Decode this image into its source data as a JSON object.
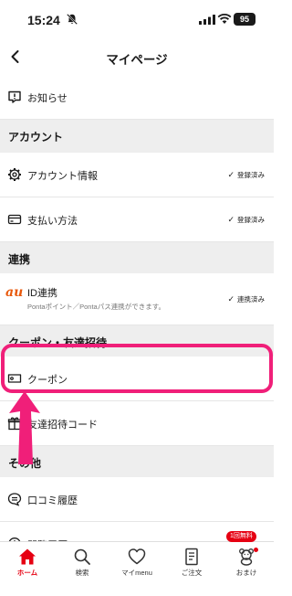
{
  "status_bar": {
    "time": "15:24",
    "battery": "95"
  },
  "header": {
    "title": "マイページ"
  },
  "notice": {
    "label": "お知らせ"
  },
  "sections": {
    "account": "アカウント",
    "link": "連携",
    "coupon": "クーポン・友達招待",
    "other": "その他"
  },
  "account_info": {
    "label": "アカウント情報",
    "status": "登録済み"
  },
  "payment": {
    "label": "支払い方法",
    "status": "登録済み"
  },
  "id_link": {
    "logo": "au",
    "label": "ID連携",
    "sub": "Pontaポイント／Pontaパス連携ができます。",
    "status": "連携済み"
  },
  "coupon_row": {
    "label": "クーポン"
  },
  "invite": {
    "label": "友達招待コード"
  },
  "review": {
    "label": "口コミ履歴"
  },
  "history": {
    "label": "閲覧履歴"
  },
  "tabbar": {
    "home": "ホーム",
    "search": "検索",
    "mymenu": "マイmenu",
    "order": "ご注文",
    "omake": "おまけ",
    "omake_badge": "1回無料"
  },
  "colors": {
    "accent": "#e60012",
    "highlight": "#f01f79",
    "au": "#e8590c"
  }
}
